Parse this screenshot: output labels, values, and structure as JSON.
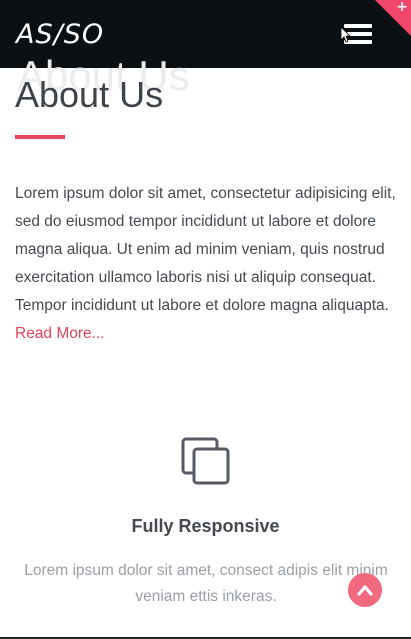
{
  "navbar": {
    "logo": "AS/SO",
    "menu_icon": "hamburger-menu-icon",
    "corner_icon": "plus-icon",
    "corner_color": "#f0466a",
    "background": "#0b1014"
  },
  "about": {
    "ghost_title": "About Us",
    "title": "About Us",
    "body": "Lorem ipsum dolor sit amet, consectetur adipisicing elit, sed do eiusmod tempor incididunt ut labore et dolore magna aliqua. Ut enim ad minim veniam, quis nostrud exercitation ullamco laboris nisi ut aliquip consequat. Tempor incididunt ut labore et dolore magna aliquapta.",
    "read_more": "Read More...",
    "accent": "#e8435d"
  },
  "feature": {
    "icon": "copy-icon",
    "title": "Fully Responsive",
    "text": "Lorem ipsum dolor sit amet, consect adipis elit minim veniam ettis inkeras."
  },
  "scroll_top": {
    "icon": "chevron-up-icon",
    "color": "#f0697f"
  }
}
